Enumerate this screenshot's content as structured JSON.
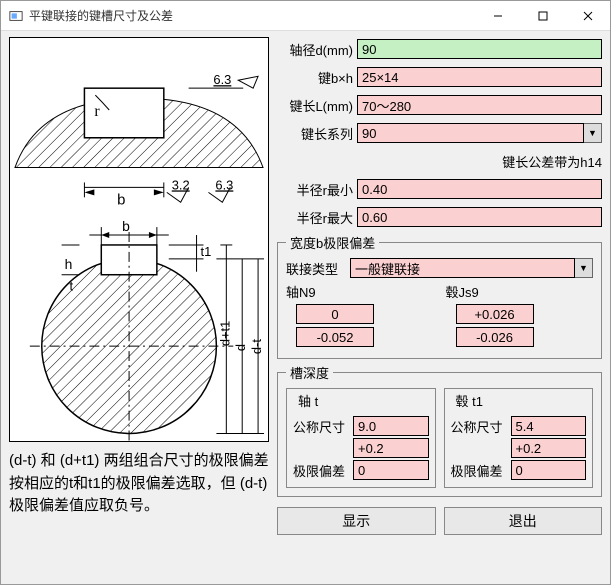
{
  "window": {
    "title": "平键联接的键槽尺寸及公差"
  },
  "fields": {
    "shaft_diameter": {
      "label": "轴径d(mm)",
      "value": "90"
    },
    "key_bxh": {
      "label": "键b×h",
      "value": "25×14"
    },
    "key_length": {
      "label": "键长L(mm)",
      "value": "70～280"
    },
    "key_length_series": {
      "label": "键长系列",
      "value": "90"
    },
    "key_length_tol_note": "键长公差带为h14",
    "r_min": {
      "label": "半径r最小",
      "value": "0.40"
    },
    "r_max": {
      "label": "半径r最大",
      "value": "0.60"
    }
  },
  "width_dev": {
    "legend": "宽度b极限偏差",
    "conn_type_label": "联接类型",
    "conn_type_value": "一般键联接",
    "shaft": {
      "label": "轴N9",
      "upper": "0",
      "lower": "-0.052"
    },
    "hub": {
      "label": "毂Js9",
      "upper": "+0.026",
      "lower": "-0.026"
    }
  },
  "groove_depth": {
    "legend": "槽深度",
    "shaft": {
      "legend": "轴 t",
      "nominal_label": "公称尺寸",
      "nominal": "9.0",
      "dev_label": "极限偏差",
      "upper": "+0.2",
      "lower": "0"
    },
    "hub": {
      "legend": "毂 t1",
      "nominal_label": "公称尺寸",
      "nominal": "5.4",
      "dev_label": "极限偏差",
      "upper": "+0.2",
      "lower": "0"
    }
  },
  "buttons": {
    "show": "显示",
    "exit": "退出"
  },
  "note": "(d-t) 和 (d+t1) 两组组合尺寸的极限偏差按相应的t和t1的极限偏差选取，但 (d-t) 极限偏差值应取负号。"
}
